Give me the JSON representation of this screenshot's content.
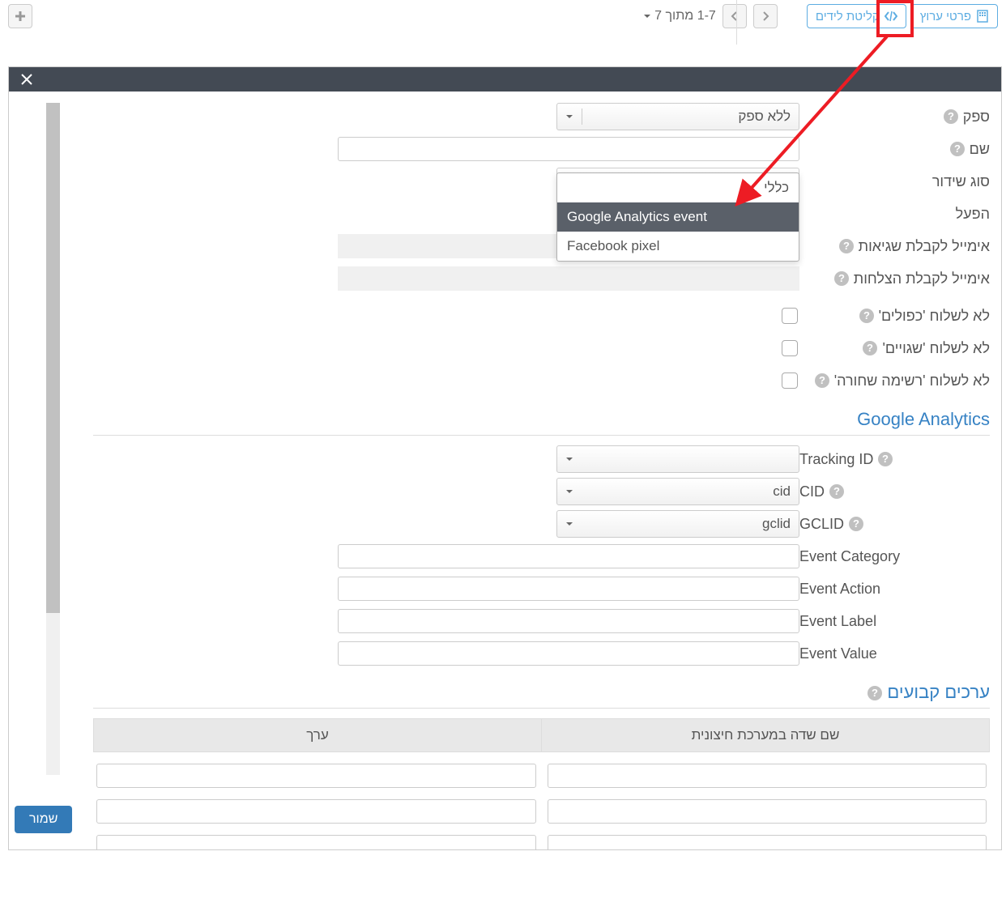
{
  "toolbar": {
    "channel_details": "פרטי ערוץ",
    "lead_intake": "קליטת לידים",
    "pager_text": "1-7 מתוך 7"
  },
  "form": {
    "labels": {
      "supplier": "ספק",
      "name": "שם",
      "broadcast_type": "סוג שידור",
      "activate": "הפעל",
      "error_email": "אימייל לקבלת שגיאות",
      "success_email": "אימייל לקבלת הצלחות",
      "no_duplicates": "לא לשלוח 'כפולים'",
      "no_errors": "לא לשלוח 'שגויים'",
      "no_blacklist": "לא לשלוח 'רשימה שחורה'"
    },
    "supplier_value": "ללא ספק",
    "broadcast_type_value": "Google Analytics event",
    "dropdown": {
      "general": "כללי",
      "ga_event": "Google Analytics event",
      "fb_pixel": "Facebook pixel"
    }
  },
  "ga_section": {
    "heading": "Google Analytics",
    "labels": {
      "tracking_id": "Tracking ID",
      "cid": "CID",
      "gclid": "GCLID",
      "event_category": "Event Category",
      "event_action": "Event Action",
      "event_label": "Event Label",
      "event_value": "Event Value"
    },
    "values": {
      "cid": "cid",
      "gclid": "gclid"
    }
  },
  "fixed_values": {
    "heading": "ערכים קבועים",
    "col_field": "שם שדה במערכת חיצונית",
    "col_value": "ערך"
  },
  "footer": {
    "save": "שמור"
  }
}
